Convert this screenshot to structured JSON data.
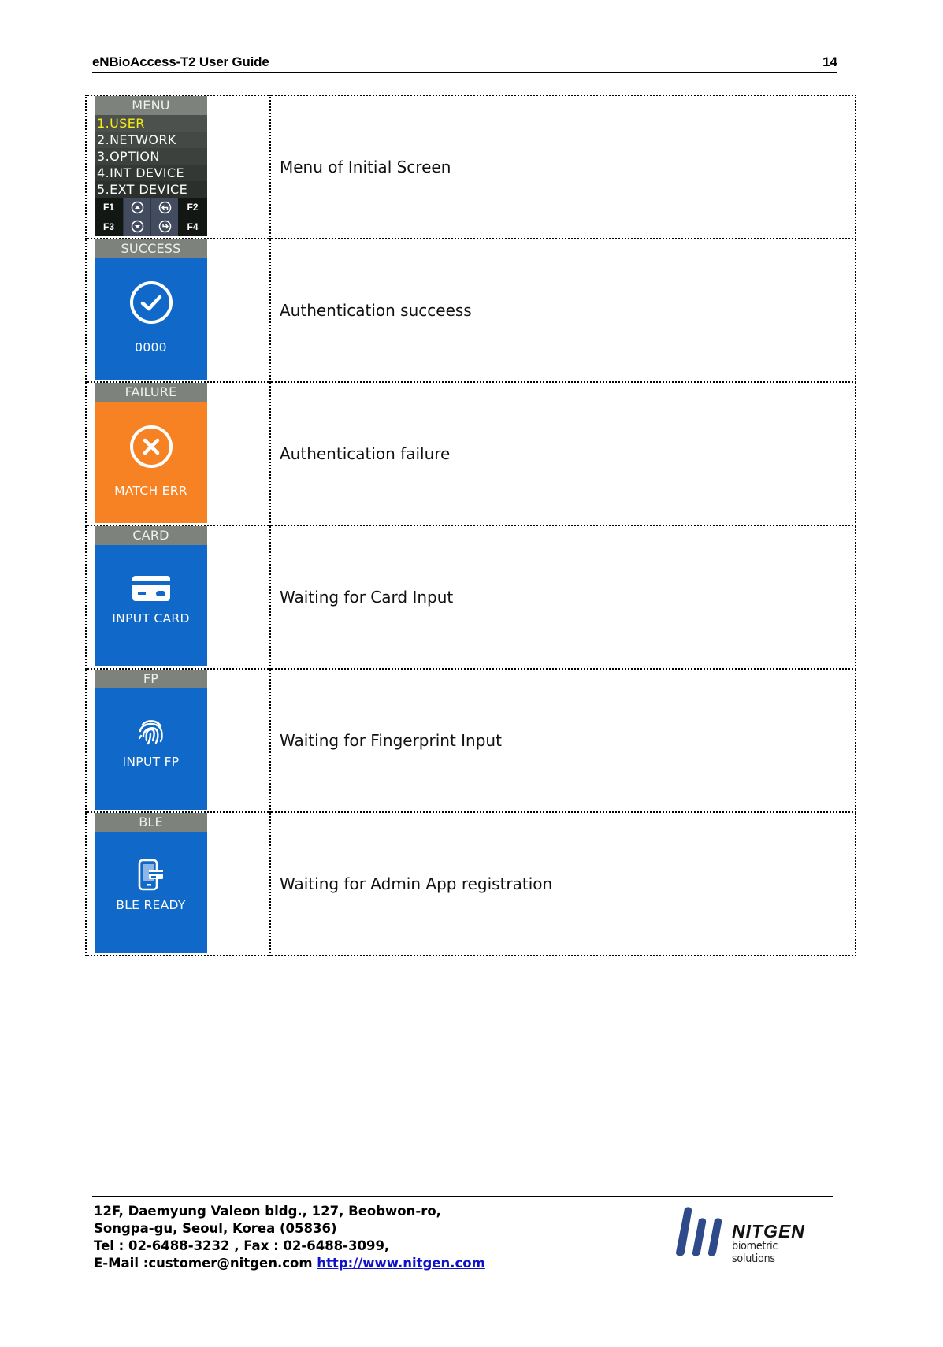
{
  "header": {
    "title": "eNBioAccess-T2 User Guide",
    "page_number": "14"
  },
  "colors": {
    "lcd_title_bar": "#7e827d",
    "lcd_blue": "#1069c9",
    "lcd_orange": "#f78223",
    "menu_highlight": "#f4ef16",
    "link": "#1111cc",
    "logo_blue": "#2e4a8a"
  },
  "rows": [
    {
      "screen_title": "MENU",
      "menu_items": [
        {
          "label": "1.USER",
          "selected": true
        },
        {
          "label": "2.NETWORK",
          "selected": false
        },
        {
          "label": "3.OPTION",
          "selected": false
        },
        {
          "label": "4.INT DEVICE",
          "selected": false
        },
        {
          "label": "5.EXT DEVICE",
          "selected": false
        }
      ],
      "function_keys": [
        "F1",
        "F2",
        "F3",
        "F4"
      ],
      "nav_icons": [
        "arrow-up-icon",
        "back-icon",
        "arrow-down-icon",
        "enter-icon"
      ],
      "description": "Menu of Initial Screen"
    },
    {
      "screen_title": "SUCCESS",
      "icon": "check-circle-icon",
      "message": "0000",
      "background": "#1069c9",
      "description": "Authentication succeess"
    },
    {
      "screen_title": "FAILURE",
      "icon": "x-circle-icon",
      "message": "MATCH ERR",
      "background": "#f78223",
      "description": "Authentication failure"
    },
    {
      "screen_title": "CARD",
      "icon": "card-icon",
      "message": "INPUT CARD",
      "background": "#1069c9",
      "description": "Waiting for Card Input"
    },
    {
      "screen_title": "FP",
      "icon": "fingerprint-icon",
      "message": "INPUT FP",
      "background": "#1069c9",
      "description": "Waiting for Fingerprint Input"
    },
    {
      "screen_title": "BLE",
      "icon": "phone-card-icon",
      "message": "BLE READY",
      "background": "#1069c9",
      "description": "Waiting for Admin App registration"
    }
  ],
  "footer": {
    "address_line1": "12F, Daemyung Valeon bldg., 127, Beobwon-ro,",
    "address_line2": "Songpa-gu, Seoul, Korea (05836)",
    "contact_line": "Tel : 02-6488-3232 , Fax : 02-6488-3099,",
    "email_label": "E-Mail :customer@nitgen.com",
    "website": "http://www.nitgen.com",
    "logo_brand": "NITGEN",
    "logo_tagline": "biometric solutions"
  }
}
